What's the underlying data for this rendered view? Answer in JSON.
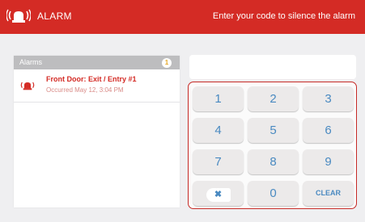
{
  "header": {
    "title": "ALARM",
    "message": "Enter your code to silence the alarm",
    "icon": "alarm-siren-icon"
  },
  "alarms": {
    "heading": "Alarms",
    "count": "1",
    "items": [
      {
        "name": "Front Door: Exit / Entry #1",
        "time": "Occurred May 12, 3:04 PM",
        "icon": "alarm-siren-icon"
      }
    ]
  },
  "code_input": {
    "value": ""
  },
  "keypad": {
    "keys": [
      "1",
      "2",
      "3",
      "4",
      "5",
      "6",
      "7",
      "8",
      "9",
      "✖",
      "0",
      "CLEAR"
    ],
    "backspace_icon": "backspace-icon"
  },
  "colors": {
    "header": "#d42b25",
    "accent": "#4a8ac1",
    "badge": "#e6a82a"
  }
}
